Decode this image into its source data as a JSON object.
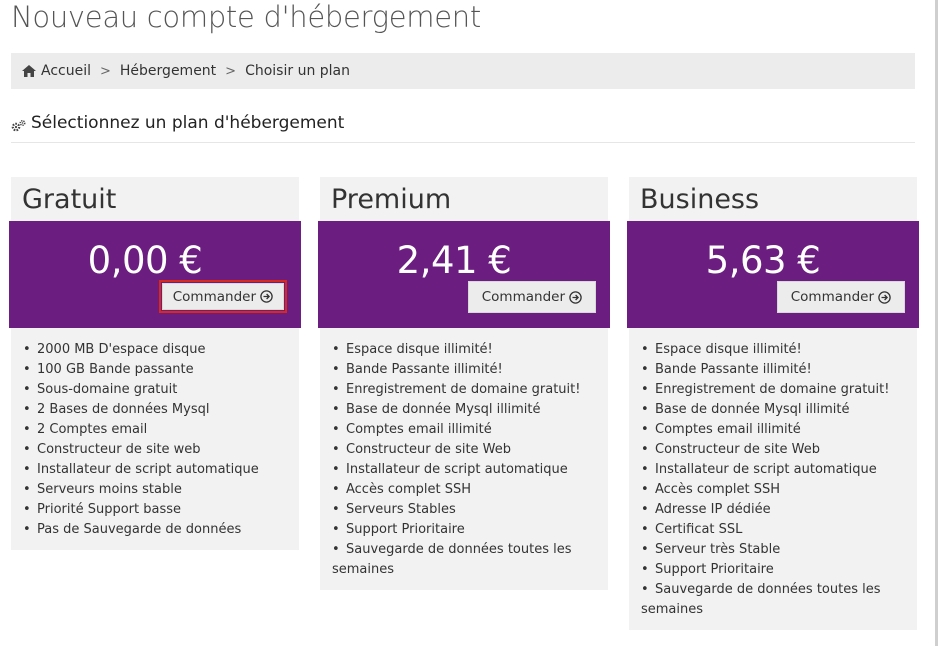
{
  "header": {
    "title": "Nouveau compte d'hébergement"
  },
  "breadcrumb": {
    "items": [
      "Accueil",
      "Hébergement",
      "Choisir un plan"
    ],
    "separator": ">"
  },
  "section": {
    "title": "Sélectionnez un plan d'hébergement"
  },
  "plans": [
    {
      "name": "Gratuit",
      "price": "0,00 €",
      "order_label": "Commander",
      "features": [
        "2000 MB D'espace disque",
        "100 GB Bande passante",
        "Sous-domaine gratuit",
        "2 Bases de données Mysql",
        "2 Comptes email",
        "Constructeur de site web",
        "Installateur de script automatique",
        "Serveurs moins stable",
        "Priorité Support basse",
        "Pas de Sauvegarde de données"
      ]
    },
    {
      "name": "Premium",
      "price": "2,41 €",
      "order_label": "Commander",
      "features": [
        "Espace disque illimité!",
        "Bande Passante illimité!",
        "Enregistrement de domaine gratuit!",
        "Base de donnée Mysql illimité",
        "Comptes email illimité",
        "Constructeur de site Web",
        "Installateur de script automatique",
        "Accès complet SSH",
        "Serveurs Stables",
        "Support Prioritaire",
        "Sauvegarde de données toutes les",
        "semaines"
      ]
    },
    {
      "name": "Business",
      "price": "5,63 €",
      "order_label": "Commander",
      "features": [
        "Espace disque illimité!",
        "Bande Passante illimité!",
        "Enregistrement de domaine gratuit!",
        "Base de donnée Mysql illimité",
        "Comptes email illimité",
        "Constructeur de site Web",
        "Installateur de script automatique",
        "Accès complet SSH",
        "Adresse IP dédiée",
        "Certificat SSL",
        "Serveur très Stable",
        "Support Prioritaire",
        "Sauvegarde de données toutes les",
        "semaines"
      ]
    }
  ],
  "colors": {
    "plan_header_bg": "#6b1e80",
    "card_bg": "#f2f2f2",
    "highlight": "#d9281c"
  },
  "icons": {
    "home": "home-icon",
    "cog": "cogs-icon",
    "order_arrow": "circle-arrow-right-icon"
  }
}
